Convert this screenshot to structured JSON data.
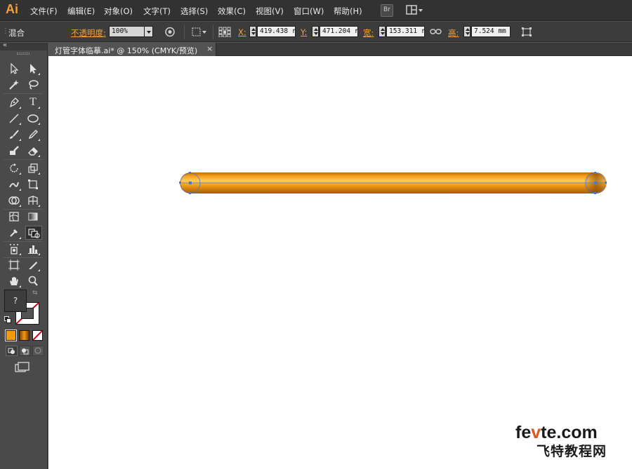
{
  "app": {
    "logo": "Ai"
  },
  "menu": [
    "文件(F)",
    "编辑(E)",
    "对象(O)",
    "文字(T)",
    "选择(S)",
    "效果(C)",
    "视图(V)",
    "窗口(W)",
    "帮助(H)"
  ],
  "menubar_buttons": {
    "bridge": "Br"
  },
  "controlbar": {
    "mode_label": "混合",
    "opacity_label": "不透明度:",
    "opacity_value": "100%",
    "x_label": "X:",
    "x_value": "419.438 r",
    "y_label": "Y:",
    "y_value": "471.204 r",
    "w_label": "宽:",
    "w_value": "153.311 r",
    "h_label": "高:",
    "h_value": "7.524 mm"
  },
  "document_tab": {
    "title": "灯管字体临摹.ai* @ 150% (CMYK/预览)",
    "close": "×"
  },
  "toolbox": {
    "collapse": "«",
    "fill_unknown": "?"
  },
  "canvas_object": {
    "type": "capsule-tube",
    "fill": "#f29a0f",
    "shadow": "#b8650a",
    "highlight": "#ffd06a",
    "selection": "#4a78d8"
  },
  "watermark": {
    "domain_pre": "fe",
    "domain_v": "v",
    "domain_post": "te.com",
    "cn": "飞特教程网"
  },
  "colors": {
    "accent": "#f3a23a",
    "menubar": "#323232",
    "panel": "#4a4a4a"
  }
}
